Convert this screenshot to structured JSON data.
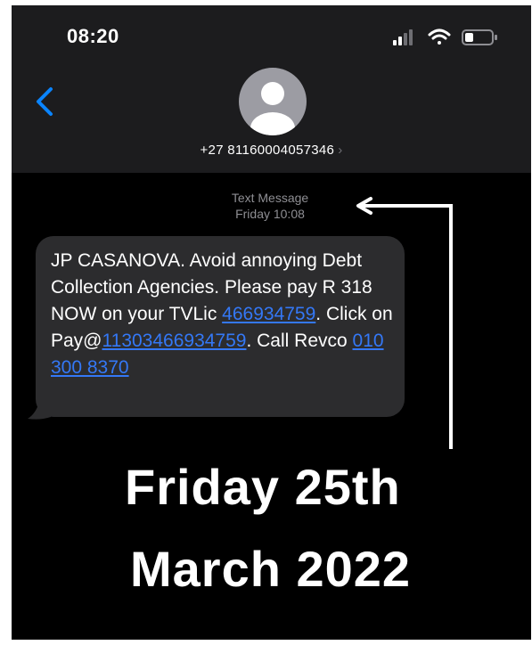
{
  "status_bar": {
    "time": "08:20"
  },
  "header": {
    "contact_number": "+27 81160004057346",
    "chevron": "›"
  },
  "message_meta": {
    "type": "Text Message",
    "timestamp": "Friday 10:08"
  },
  "message": {
    "text_1": "JP CASANOVA. Avoid annoying Debt Collection Agencies. Please pay R 318 NOW on your TVLic ",
    "link_1": "466934759",
    "text_2": ". Click on Pay@",
    "link_2": "11303466934759",
    "text_3": ". Call Revco ",
    "link_3": "010 300 8370"
  },
  "annotation": {
    "line1": "Friday 25th",
    "line2": "March 2022"
  },
  "colors": {
    "link": "#3478f6",
    "bubble": "#2c2c2e",
    "header": "#1c1c1e",
    "back_arrow": "#0a84ff"
  },
  "icons": [
    "signal-icon",
    "wifi-icon",
    "battery-icon",
    "back-chevron-icon",
    "avatar-icon"
  ]
}
